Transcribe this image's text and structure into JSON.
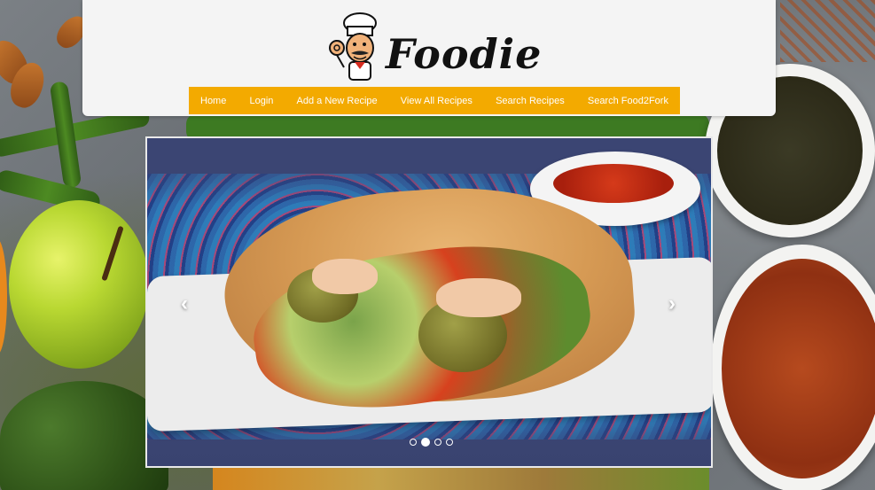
{
  "header": {
    "brand": "Foodie"
  },
  "nav": {
    "items": [
      "Home",
      "Login",
      "Add a New Recipe",
      "View All Recipes",
      "Search Recipes",
      "Search Food2Fork"
    ]
  },
  "carousel": {
    "prev_icon": "‹",
    "next_icon": "›",
    "slide_count": 4,
    "active_slide": 2
  },
  "colors": {
    "nav_bg": "#f3aa00",
    "header_bg": "#f4f4f4"
  }
}
